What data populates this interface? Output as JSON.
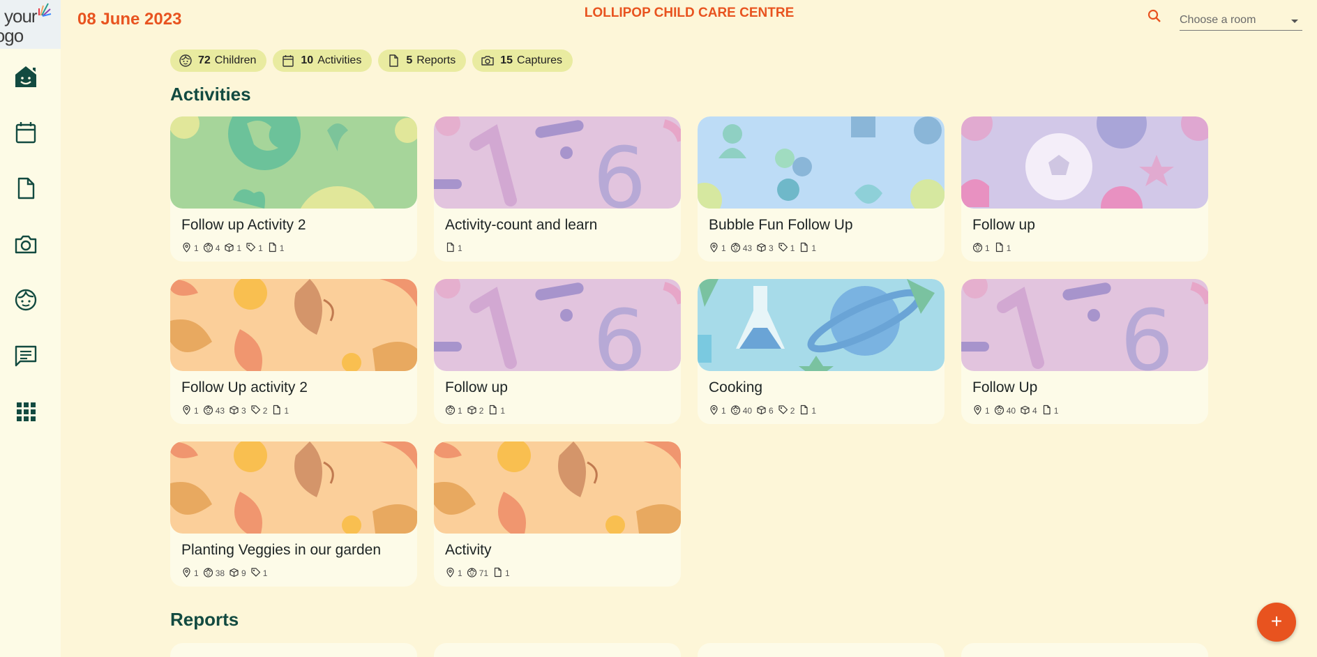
{
  "header": {
    "date": "08 June 2023",
    "centre_name": "LOLLIPOP CHILD CARE CENTRE",
    "room_placeholder": "Choose a room"
  },
  "logo": {
    "line1": "your",
    "line2": "logo here"
  },
  "sidebar": {
    "items": [
      {
        "name": "home",
        "icon": "home-smile-icon"
      },
      {
        "name": "calendar",
        "icon": "calendar-icon"
      },
      {
        "name": "reports",
        "icon": "document-icon"
      },
      {
        "name": "captures",
        "icon": "camera-icon"
      },
      {
        "name": "children",
        "icon": "child-face-icon"
      },
      {
        "name": "messages",
        "icon": "message-icon"
      },
      {
        "name": "apps",
        "icon": "grid-icon"
      }
    ]
  },
  "summary": [
    {
      "count": "72",
      "label": "Children",
      "icon": "child-face-icon"
    },
    {
      "count": "10",
      "label": "Activities",
      "icon": "calendar-icon"
    },
    {
      "count": "5",
      "label": "Reports",
      "icon": "document-icon"
    },
    {
      "count": "15",
      "label": "Captures",
      "icon": "camera-icon"
    }
  ],
  "sections": {
    "activities": "Activities",
    "reports": "Reports"
  },
  "activities": [
    {
      "title": "Follow up Activity 2",
      "theme": "green-earth",
      "meta": [
        {
          "icon": "location-icon",
          "value": "1"
        },
        {
          "icon": "child-face-icon",
          "value": "4"
        },
        {
          "icon": "box-icon",
          "value": "1"
        },
        {
          "icon": "tag-icon",
          "value": "1"
        },
        {
          "icon": "document-icon",
          "value": "1"
        }
      ]
    },
    {
      "title": "Activity-count and learn",
      "theme": "purple-numbers",
      "meta": [
        {
          "icon": "document-icon",
          "value": "1"
        }
      ]
    },
    {
      "title": "Bubble Fun Follow Up",
      "theme": "blue-people",
      "meta": [
        {
          "icon": "location-icon",
          "value": "1"
        },
        {
          "icon": "child-face-icon",
          "value": "43"
        },
        {
          "icon": "box-icon",
          "value": "3"
        },
        {
          "icon": "tag-icon",
          "value": "1"
        },
        {
          "icon": "document-icon",
          "value": "1"
        }
      ]
    },
    {
      "title": "Follow up",
      "theme": "lilac-sports",
      "meta": [
        {
          "icon": "child-face-icon",
          "value": "1"
        },
        {
          "icon": "document-icon",
          "value": "1"
        }
      ]
    },
    {
      "title": "Follow Up activity 2",
      "theme": "orange-leaves",
      "meta": [
        {
          "icon": "location-icon",
          "value": "1"
        },
        {
          "icon": "child-face-icon",
          "value": "43"
        },
        {
          "icon": "box-icon",
          "value": "3"
        },
        {
          "icon": "tag-icon",
          "value": "2"
        },
        {
          "icon": "document-icon",
          "value": "1"
        }
      ]
    },
    {
      "title": "Follow up",
      "theme": "purple-numbers",
      "meta": [
        {
          "icon": "child-face-icon",
          "value": "1"
        },
        {
          "icon": "box-icon",
          "value": "2"
        },
        {
          "icon": "document-icon",
          "value": "1"
        }
      ]
    },
    {
      "title": "Cooking",
      "theme": "blue-science",
      "meta": [
        {
          "icon": "location-icon",
          "value": "1"
        },
        {
          "icon": "child-face-icon",
          "value": "40"
        },
        {
          "icon": "box-icon",
          "value": "6"
        },
        {
          "icon": "tag-icon",
          "value": "2"
        },
        {
          "icon": "document-icon",
          "value": "1"
        }
      ]
    },
    {
      "title": "Follow Up",
      "theme": "purple-numbers",
      "meta": [
        {
          "icon": "location-icon",
          "value": "1"
        },
        {
          "icon": "child-face-icon",
          "value": "40"
        },
        {
          "icon": "box-icon",
          "value": "4"
        },
        {
          "icon": "document-icon",
          "value": "1"
        }
      ]
    },
    {
      "title": "Planting Veggies in our garden",
      "theme": "orange-leaves",
      "meta": [
        {
          "icon": "location-icon",
          "value": "1"
        },
        {
          "icon": "child-face-icon",
          "value": "38"
        },
        {
          "icon": "box-icon",
          "value": "9"
        },
        {
          "icon": "tag-icon",
          "value": "1"
        }
      ]
    },
    {
      "title": "Activity",
      "theme": "orange-leaves",
      "meta": [
        {
          "icon": "location-icon",
          "value": "1"
        },
        {
          "icon": "child-face-icon",
          "value": "71"
        },
        {
          "icon": "document-icon",
          "value": "1"
        }
      ]
    }
  ],
  "fab": {
    "label": "+"
  },
  "colors": {
    "accent": "#e8531f",
    "title_green": "#124a40",
    "chip": "#e9eba0",
    "background": "#fdf6d8"
  }
}
